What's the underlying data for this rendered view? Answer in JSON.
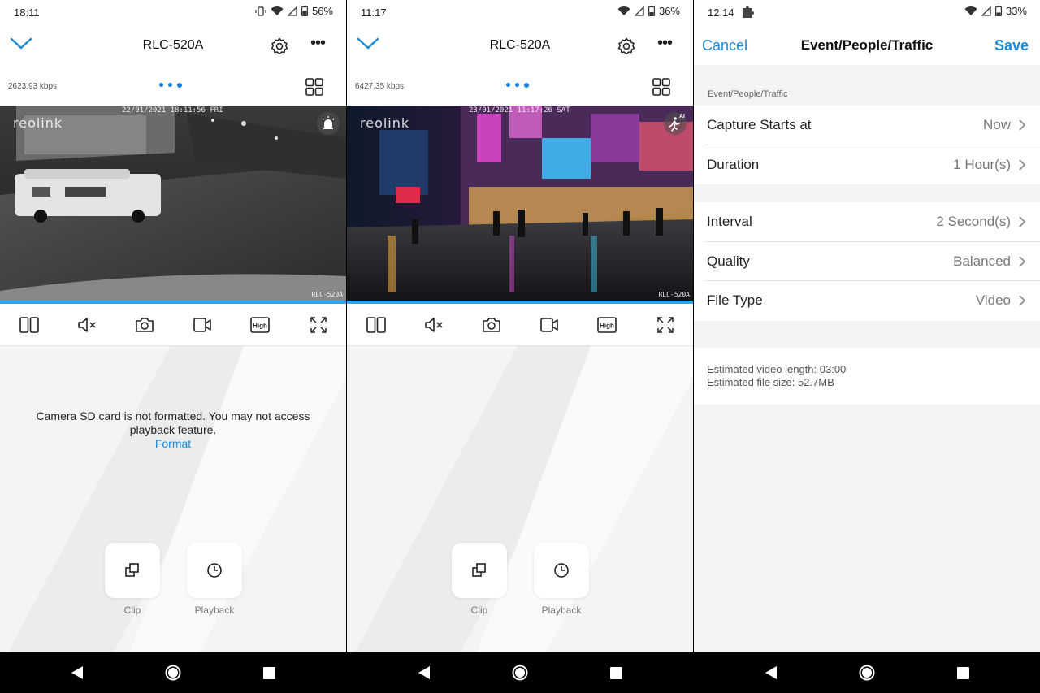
{
  "screens": {
    "left": {
      "status": {
        "time": "18:11",
        "battery": "56%"
      },
      "camera_name": "RLC-520A",
      "bitrate": "2623.93 kbps",
      "video": {
        "brand_overlay": "reolink",
        "timestamp_overlay": "22/01/2021 18:11:56 FRI",
        "camera_label_overlay": "RLC-520A"
      },
      "message": "Camera SD card is not formatted. You may not access playback feature.",
      "format_link": "Format",
      "clip_label": "Clip",
      "playback_label": "Playback"
    },
    "middle": {
      "status": {
        "time": "11:17",
        "battery": "36%"
      },
      "camera_name": "RLC-520A",
      "bitrate": "6427.35 kbps",
      "video": {
        "brand_overlay": "reolink",
        "timestamp_overlay": "23/01/2021 11:17:26 SAT",
        "camera_label_overlay": "RLC-520A",
        "ai_badge": "AI"
      },
      "clip_label": "Clip",
      "playback_label": "Playback"
    },
    "right": {
      "status": {
        "time": "12:14",
        "battery": "33%"
      },
      "cancel_label": "Cancel",
      "title": "Event/People/Traffic",
      "save_label": "Save",
      "section_label": "Event/People/Traffic",
      "group1": [
        {
          "label": "Capture Starts at",
          "value": "Now"
        },
        {
          "label": "Duration",
          "value": "1 Hour(s)"
        }
      ],
      "group2": [
        {
          "label": "Interval",
          "value": "2 Second(s)"
        },
        {
          "label": "Quality",
          "value": "Balanced"
        },
        {
          "label": "File Type",
          "value": "Video"
        }
      ],
      "estimate_length": "Estimated video length: 03:00",
      "estimate_size": "Estimated file size: 52.7MB"
    }
  },
  "colors": {
    "accent": "#1a8ad4",
    "progress": "#2aa6ec",
    "dot": "#1a7ee0"
  },
  "icons": {
    "control_bar": [
      "split-view-icon",
      "mute-icon",
      "snapshot-icon",
      "record-icon",
      "quality-high-icon",
      "fullscreen-icon"
    ],
    "quality_badge_text": "High"
  }
}
